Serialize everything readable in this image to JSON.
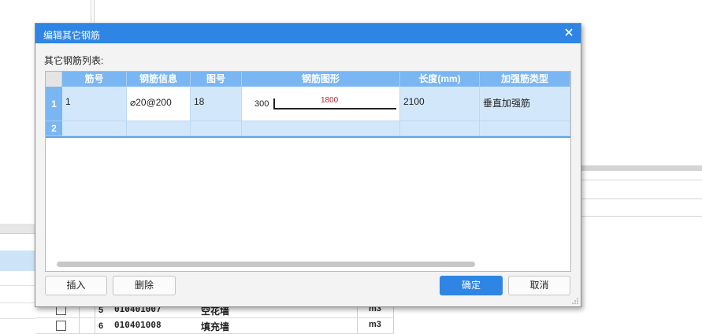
{
  "background": {
    "rows": [
      {
        "num": "5",
        "code": "010401007",
        "name": "空花墙",
        "unit": "m3"
      },
      {
        "num": "6",
        "code": "010401008",
        "name": "填充墙",
        "unit": "m3"
      }
    ]
  },
  "dialog": {
    "title": "编辑其它钢筋",
    "list_label": "其它钢筋列表:",
    "columns": [
      "筋号",
      "钢筋信息",
      "图号",
      "钢筋图形",
      "长度(mm)",
      "加强筋类型"
    ],
    "rows": [
      {
        "row_num": "1",
        "bar_no": "1",
        "bar_info": "⌀20@200",
        "fig_no": "18",
        "shape_left": "300",
        "shape_span": "1800",
        "length": "2100",
        "type": "垂直加强筋"
      },
      {
        "row_num": "2",
        "bar_no": "",
        "bar_info": "",
        "fig_no": "",
        "shape_left": "",
        "shape_span": "",
        "length": "",
        "type": ""
      }
    ],
    "buttons": {
      "insert": "插入",
      "delete": "删除",
      "ok": "确定",
      "cancel": "取消"
    }
  },
  "colors": {
    "title_bar": "#2f85e3",
    "grid_header": "#7ab6f2",
    "selected_row": "#d3e7fb",
    "dimension_text": "#b3262b"
  }
}
